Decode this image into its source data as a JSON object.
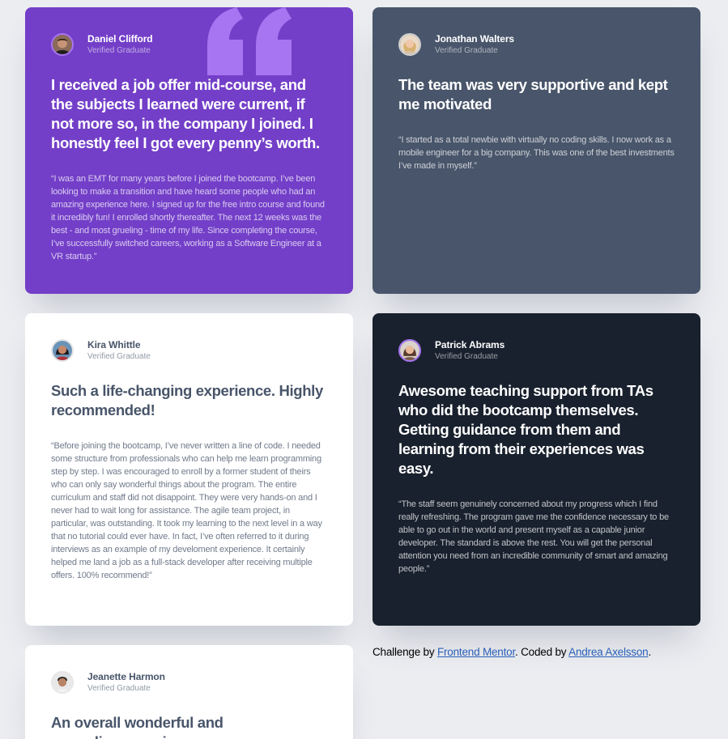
{
  "theme": {
    "page_background": "#ecedf1",
    "moderate_violet": "#733fc8",
    "grayish_blue": "#48556a",
    "very_dark_blue": "#19212e",
    "white": "#ffffff",
    "link_color": "#2a5fb7"
  },
  "testimonials": [
    {
      "name": "Daniel Clifford",
      "role": "Verified Graduate",
      "headline": "I received a job offer mid-course, and the subjects I learned were current, if not more so, in the company I joined. I honestly feel I got every penny’s worth.",
      "body": "“I was an EMT for many years before I joined the bootcamp. I’ve been looking to make a transition and have heard some people who had an amazing experience here. I signed up for the free intro course and found it incredibly fun! I enrolled shortly thereafter. The next 12 weeks was the best - and most grueling - time of my life. Since completing the course, I’ve successfully switched careers, working as a Software Engineer at a VR startup.”",
      "avatar_icon": "avatar-man-dark-hair-icon",
      "decoration_icon": "quotation-mark-icon"
    },
    {
      "name": "Jonathan Walters",
      "role": "Verified Graduate",
      "headline": "The team was very supportive and kept me motivated",
      "body": "“I started as a total newbie with virtually no coding skills. I now work as a mobile engineer for a big company. This was one of the best investments I’ve made in myself.”",
      "avatar_icon": "avatar-blonde-person-icon"
    },
    {
      "name": "Kira Whittle",
      "role": "Verified Graduate",
      "headline": "Such a life-changing experience. Highly recommended!",
      "body": "“Before joining the bootcamp, I’ve never written a line of code. I needed some structure from professionals who can help me learn programming step by step. I was encouraged to enroll by a former student of theirs who can only say wonderful things about the program. The entire curriculum and staff did not disappoint. They were very hands-on and I never had to wait long for assistance. The agile team project, in particular, was outstanding. It took my learning to the next level in a way that no tutorial could ever have. In fact, I’ve often referred to it during interviews as an example of my develoment experience. It certainly helped me land a job as a full-stack developer after receiving multiple offers. 100% recommend!”",
      "avatar_icon": "avatar-woman-dark-hair-icon"
    },
    {
      "name": "Patrick Abrams",
      "role": "Verified Graduate",
      "headline": "Awesome teaching support from TAs who did the bootcamp themselves. Getting guidance from them and learning from their experiences was easy.",
      "body": "“The staff seem genuinely concerned about my progress which I find really refreshing. The program gave me the confidence necessary to be able to go out in the world and present myself as a capable junior developer. The standard is above the rest. You will get the personal attention you need from an incredible community of smart and amazing people.”",
      "avatar_icon": "avatar-woman-brown-hair-icon"
    },
    {
      "name": "Jeanette Harmon",
      "role": "Verified Graduate",
      "headline": "An overall wonderful and rewarding experience",
      "body": "",
      "avatar_icon": "avatar-person-dark-hair-icon"
    }
  ],
  "attribution": {
    "prefix": "Challenge by ",
    "link1": "Frontend Mentor",
    "middle": ". Coded by ",
    "link2": "Andrea Axelsson",
    "suffix": "."
  }
}
